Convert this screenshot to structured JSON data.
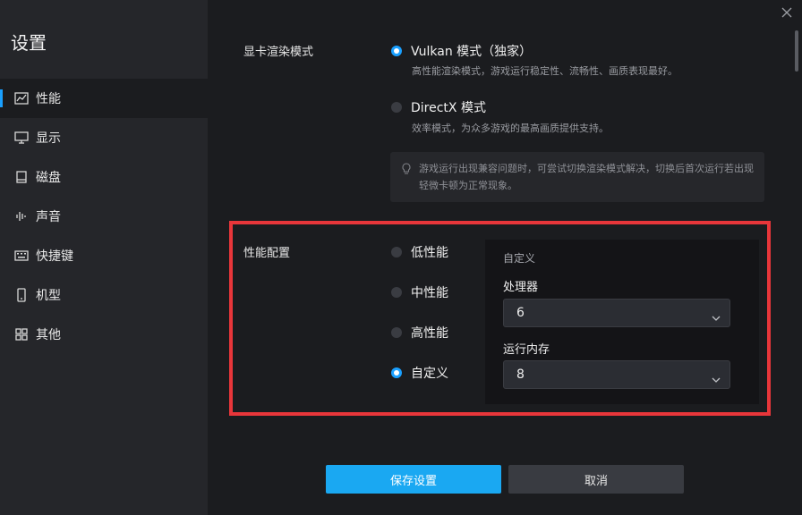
{
  "sidebar": {
    "title": "设置",
    "items": [
      {
        "label": "性能",
        "icon": "performance-chart-icon",
        "active": true
      },
      {
        "label": "显示",
        "icon": "monitor-icon",
        "active": false
      },
      {
        "label": "磁盘",
        "icon": "disk-icon",
        "active": false
      },
      {
        "label": "声音",
        "icon": "sound-wave-icon",
        "active": false
      },
      {
        "label": "快捷键",
        "icon": "keyboard-icon",
        "active": false
      },
      {
        "label": "机型",
        "icon": "phone-icon",
        "active": false
      },
      {
        "label": "其他",
        "icon": "grid-icon",
        "active": false
      }
    ]
  },
  "render_mode": {
    "label": "显卡渲染模式",
    "options": [
      {
        "label": "Vulkan 模式（独家）",
        "desc": "高性能渲染模式，游戏运行稳定性、流畅性、画质表现最好。",
        "checked": true
      },
      {
        "label": "DirectX 模式",
        "desc": "效率模式，为众多游戏的最高画质提供支持。",
        "checked": false
      }
    ],
    "tip": "游戏运行出现兼容问题时，可尝试切换渲染模式解决，切换后首次运行若出现轻微卡顿为正常现象。"
  },
  "performance": {
    "label": "性能配置",
    "options": [
      {
        "label": "低性能",
        "checked": false
      },
      {
        "label": "中性能",
        "checked": false
      },
      {
        "label": "高性能",
        "checked": false
      },
      {
        "label": "自定义",
        "checked": true
      }
    ],
    "custom": {
      "heading": "自定义",
      "cpu_label": "处理器",
      "cpu_value": "6",
      "memory_label": "运行内存",
      "memory_value": "8"
    }
  },
  "buttons": {
    "save": "保存设置",
    "cancel": "取消"
  },
  "colors": {
    "accent": "#1aa0ff",
    "highlight_border": "#e8363a"
  }
}
